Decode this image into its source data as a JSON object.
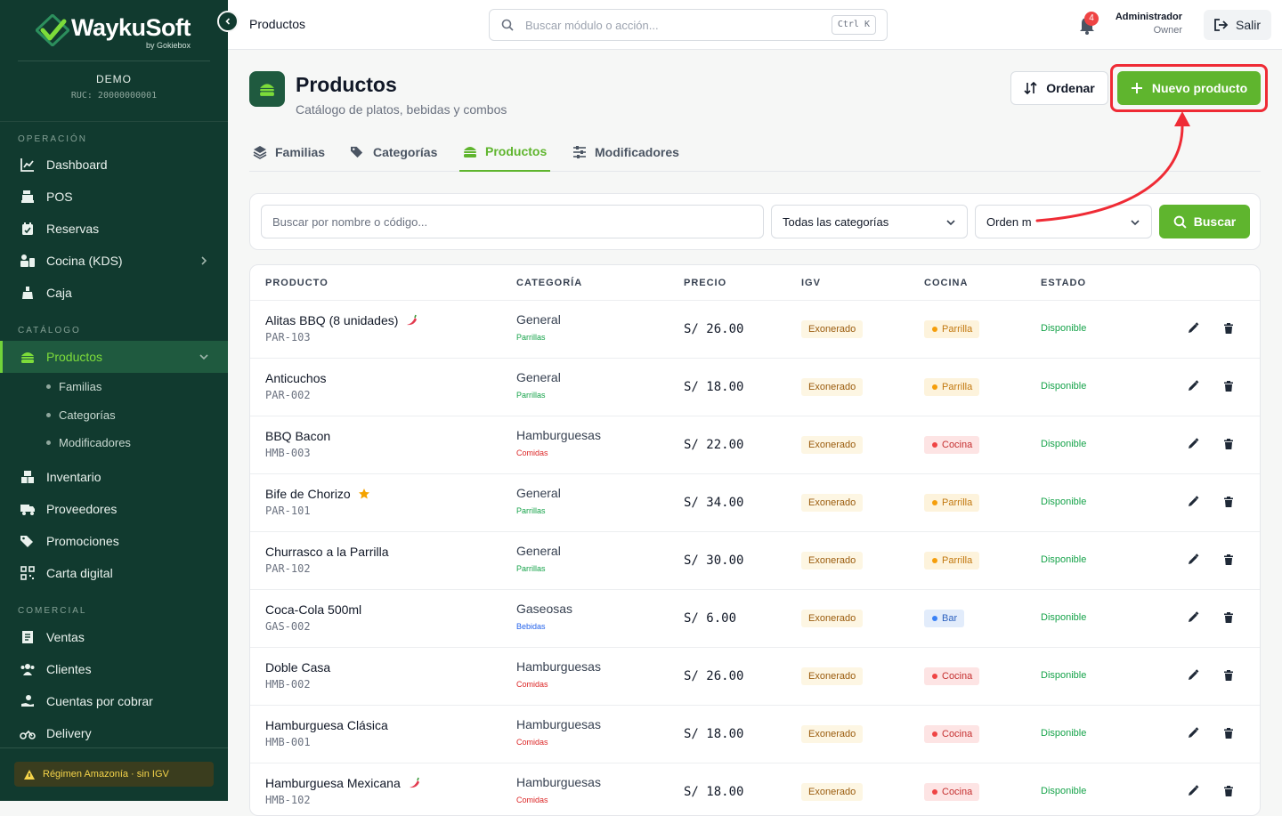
{
  "brand": {
    "name": "WaykuSoft",
    "by": "by Gokiebox"
  },
  "company": {
    "name": "DEMO",
    "ruc": "RUC: 20000000001"
  },
  "sidebar": {
    "sections": [
      {
        "label": "OPERACIÓN"
      },
      {
        "label": "CATÁLOGO"
      },
      {
        "label": "COMERCIAL"
      }
    ],
    "items": [
      {
        "label": "Dashboard",
        "icon": "chart-line-icon"
      },
      {
        "label": "POS",
        "icon": "cash-register-icon"
      },
      {
        "label": "Reservas",
        "icon": "calendar-check-icon"
      },
      {
        "label": "Cocina (KDS)",
        "icon": "kitchen-icon"
      },
      {
        "label": "Caja",
        "icon": "cash-box-icon"
      },
      {
        "label": "Productos",
        "icon": "burger-icon"
      },
      {
        "label": "Inventario",
        "icon": "boxes-icon"
      },
      {
        "label": "Proveedores",
        "icon": "truck-icon"
      },
      {
        "label": "Promociones",
        "icon": "tags-icon"
      },
      {
        "label": "Carta digital",
        "icon": "qrcode-icon"
      },
      {
        "label": "Ventas",
        "icon": "receipt-icon"
      },
      {
        "label": "Clientes",
        "icon": "users-icon"
      },
      {
        "label": "Cuentas por cobrar",
        "icon": "hand-coin-icon"
      },
      {
        "label": "Delivery",
        "icon": "motorcycle-icon"
      }
    ],
    "subitems": [
      {
        "label": "Familias"
      },
      {
        "label": "Categorías"
      },
      {
        "label": "Modificadores"
      }
    ],
    "regime": "Régimen Amazonía · sin IGV"
  },
  "topbar": {
    "breadcrumb": "Productos",
    "search_placeholder": "Buscar módulo o acción...",
    "shortcut": "Ctrl K",
    "notifications": "4",
    "user_name": "Administrador",
    "user_role": "Owner",
    "logout": "Salir"
  },
  "page": {
    "title": "Productos",
    "subtitle": "Catálogo de platos, bebidas y combos",
    "order_button": "Ordenar",
    "new_button": "Nuevo producto"
  },
  "tabs": [
    {
      "label": "Familias"
    },
    {
      "label": "Categorías"
    },
    {
      "label": "Productos"
    },
    {
      "label": "Modificadores"
    }
  ],
  "filters": {
    "search_placeholder": "Buscar por nombre o código...",
    "category": "Todas las categorías",
    "order": "Orden m",
    "search_button": "Buscar"
  },
  "table": {
    "headers": [
      "PRODUCTO",
      "CATEGORÍA",
      "PRECIO",
      "IGV",
      "COCINA",
      "ESTADO"
    ],
    "rows": [
      {
        "name": "Alitas BBQ (8 unidades)",
        "code": "PAR-103",
        "category": "General",
        "family": "Parrillas",
        "price": "S/ 26.00",
        "igv": "Exonerado",
        "kitchen": "Parrilla",
        "status": "Disponible",
        "mark": "chili-icon"
      },
      {
        "name": "Anticuchos",
        "code": "PAR-002",
        "category": "General",
        "family": "Parrillas",
        "price": "S/ 18.00",
        "igv": "Exonerado",
        "kitchen": "Parrilla",
        "status": "Disponible",
        "mark": ""
      },
      {
        "name": "BBQ Bacon",
        "code": "HMB-003",
        "category": "Hamburguesas",
        "family": "Comidas",
        "price": "S/ 22.00",
        "igv": "Exonerado",
        "kitchen": "Cocina",
        "status": "Disponible",
        "mark": ""
      },
      {
        "name": "Bife de Chorizo",
        "code": "PAR-101",
        "category": "General",
        "family": "Parrillas",
        "price": "S/ 34.00",
        "igv": "Exonerado",
        "kitchen": "Parrilla",
        "status": "Disponible",
        "mark": "star-icon"
      },
      {
        "name": "Churrasco a la Parrilla",
        "code": "PAR-102",
        "category": "General",
        "family": "Parrillas",
        "price": "S/ 30.00",
        "igv": "Exonerado",
        "kitchen": "Parrilla",
        "status": "Disponible",
        "mark": ""
      },
      {
        "name": "Coca-Cola 500ml",
        "code": "GAS-002",
        "category": "Gaseosas",
        "family": "Bebidas",
        "price": "S/ 6.00",
        "igv": "Exonerado",
        "kitchen": "Bar",
        "status": "Disponible",
        "mark": ""
      },
      {
        "name": "Doble Casa",
        "code": "HMB-002",
        "category": "Hamburguesas",
        "family": "Comidas",
        "price": "S/ 26.00",
        "igv": "Exonerado",
        "kitchen": "Cocina",
        "status": "Disponible",
        "mark": ""
      },
      {
        "name": "Hamburguesa Clásica",
        "code": "HMB-001",
        "category": "Hamburguesas",
        "family": "Comidas",
        "price": "S/ 18.00",
        "igv": "Exonerado",
        "kitchen": "Cocina",
        "status": "Disponible",
        "mark": ""
      },
      {
        "name": "Hamburguesa Mexicana",
        "code": "HMB-102",
        "category": "Hamburguesas",
        "family": "Comidas",
        "price": "S/ 18.00",
        "igv": "Exonerado",
        "kitchen": "Cocina",
        "status": "Disponible",
        "mark": "chili-icon"
      }
    ]
  },
  "colors": {
    "sidebar": "#113a2f",
    "accent": "#5fb52e",
    "highlight": "#ef2b35",
    "family": {
      "Parrillas": "#16a34a",
      "Comidas": "#dc2626",
      "Bebidas": "#2563eb"
    },
    "kitchen": {
      "Parrilla": {
        "bg": "#fdf3dc",
        "fg": "#c2780f",
        "dot": "#f59e0b"
      },
      "Cocina": {
        "bg": "#fde4e4",
        "fg": "#c53030",
        "dot": "#ef4444"
      },
      "Bar": {
        "bg": "#e2ecfb",
        "fg": "#2f63c0",
        "dot": "#3b82f6"
      }
    }
  }
}
